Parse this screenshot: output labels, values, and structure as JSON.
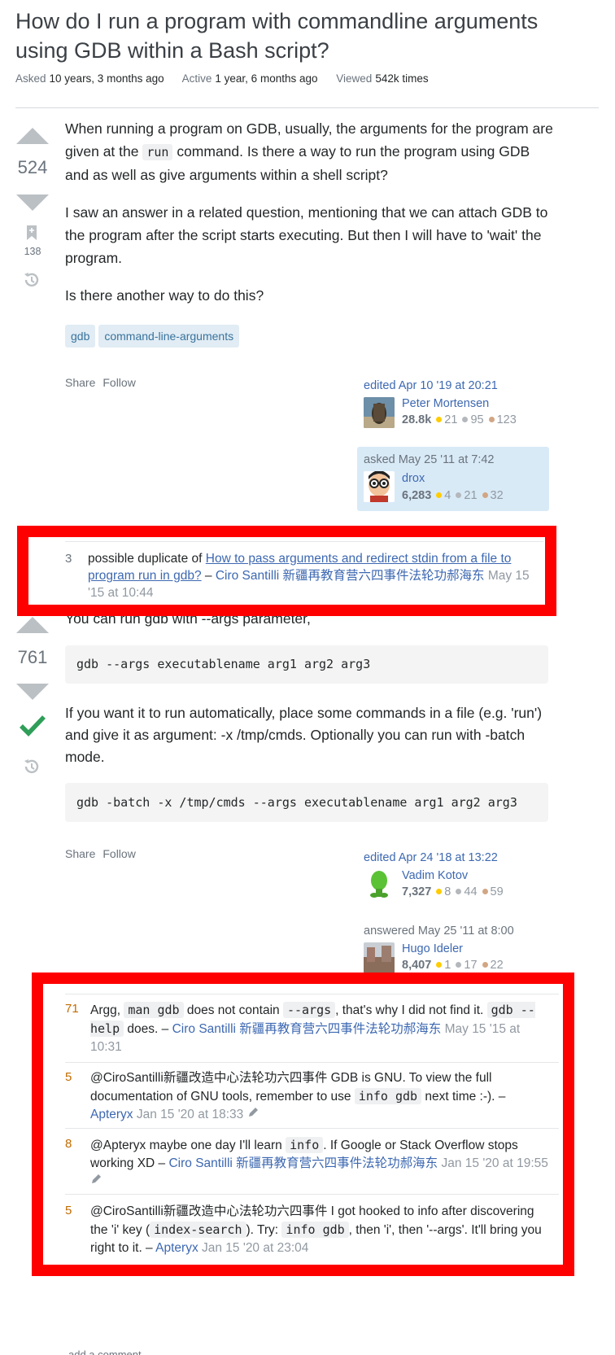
{
  "question": {
    "title": "How do I run a program with commandline arguments using GDB within a Bash script?",
    "asked_label": "Asked",
    "asked_value": "10 years, 3 months ago",
    "active_label": "Active",
    "active_value": "1 year, 6 months ago",
    "viewed_label": "Viewed",
    "viewed_value": "542k times",
    "votes": "524",
    "bookmarks": "138",
    "body_p1_a": "When running a program on GDB, usually, the arguments for the program are given at the ",
    "body_p1_code": "run",
    "body_p1_b": " command. Is there a way to run the program using GDB and as well as give arguments within a shell script?",
    "body_p2": "I saw an answer in a related question, mentioning that we can attach GDB to the program after the script starts executing. But then I will have to 'wait' the program.",
    "body_p3": "Is there another way to do this?",
    "tags": [
      "gdb",
      "command-line-arguments"
    ],
    "share": "Share",
    "follow": "Follow",
    "edited": {
      "time": "edited Apr 10 '19 at 20:21",
      "name": "Peter Mortensen",
      "rep": "28.8k",
      "gold": "21",
      "silver": "95",
      "bronze": "123"
    },
    "asked": {
      "time": "asked May 25 '11 at 7:42",
      "name": "drox",
      "rep": "6,283",
      "gold": "4",
      "silver": "21",
      "bronze": "32"
    },
    "comment": {
      "score": "3",
      "text": "possible duplicate of ",
      "link": "How to pass arguments and redirect stdin from a file to program run in gdb?",
      "dash": " – ",
      "user": "Ciro Santilli 新疆再教育营六四事件法轮功郝海东",
      "date": " May 15 '15 at 10:44"
    }
  },
  "answer": {
    "votes": "761",
    "p1": "You can run gdb with --args parameter,",
    "code1": "gdb --args executablename arg1 arg2 arg3",
    "p2": "If you want it to run automatically, place some commands in a file (e.g. 'run') and give it as argument: -x /tmp/cmds. Optionally you can run with -batch mode.",
    "code2": "gdb -batch -x /tmp/cmds --args executablename arg1 arg2 arg3",
    "share": "Share",
    "follow": "Follow",
    "edited": {
      "time": "edited Apr 24 '18 at 13:22",
      "name": "Vadim Kotov",
      "rep": "7,327",
      "gold": "8",
      "silver": "44",
      "bronze": "59"
    },
    "answered": {
      "time": "answered May 25 '11 at 8:00",
      "name": "Hugo Ideler",
      "rep": "8,407",
      "gold": "1",
      "silver": "17",
      "bronze": "22"
    },
    "comments": [
      {
        "score": "71",
        "t1": "Argg, ",
        "c1": "man gdb",
        "t2": " does not contain ",
        "c2": "--args",
        "t3": ", that's why I did not find it. ",
        "c3": "gdb --help",
        "t4": " does. – ",
        "user": "Ciro Santilli 新疆再教育营六四事件法轮功郝海东",
        "date": " May 15 '15 at 10:31"
      },
      {
        "score": "5",
        "t1": "@CiroSantilli新疆改造中心法轮功六四事件 GDB is GNU. To view the full documentation of GNU tools, remember to use ",
        "c1": "info gdb",
        "t2": " next time :-). – ",
        "user": "Apteryx",
        "date": " Jan 15 '20 at 18:33"
      },
      {
        "score": "8",
        "t1": "@Apteryx maybe one day I'll learn ",
        "c1": "info",
        "t2": ". If Google or Stack Overflow stops working XD – ",
        "user": "Ciro Santilli 新疆再教育营六四事件法轮功郝海东",
        "date": " Jan 15 '20 at 19:55"
      },
      {
        "score": "5",
        "t1": "@CiroSantilli新疆改造中心法轮功六四事件 I got hooked to info after discovering the 'i' key (",
        "c1": "index-search",
        "t2": "). Try: ",
        "c2": "info gdb",
        "t3": ", then 'i', then '--args'. It'll bring you right to it. – ",
        "user": "Apteryx",
        "date": " Jan 15 '20 at 23:04"
      }
    ],
    "add_comment": "add a comment"
  },
  "colors": {
    "highlight_frame": "#ff0000",
    "link": "#3d68b1",
    "accepted": "#2f9e58"
  }
}
